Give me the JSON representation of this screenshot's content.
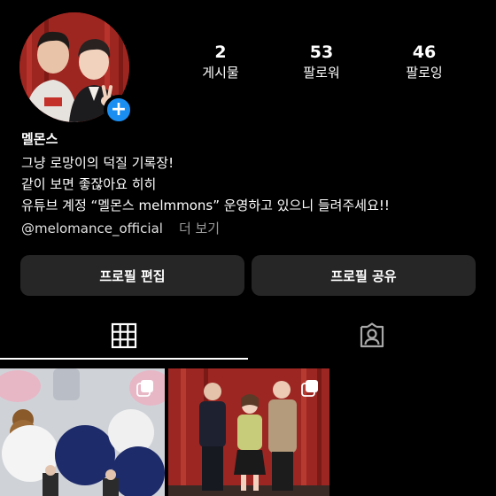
{
  "profile": {
    "display_name": "멜몬스",
    "bio_lines": [
      "그냥 로망이의 덕질 기록장!",
      "같이 보면 좋잖아요 히히",
      "유튜브 계정 “멜몬스 melmmons” 운영하고 있으니 들려주세요!!"
    ],
    "link_handle": "@melomance_official",
    "more_label": "더 보기"
  },
  "stats": [
    {
      "value": "2",
      "label": "게시물"
    },
    {
      "value": "53",
      "label": "팔로워"
    },
    {
      "value": "46",
      "label": "팔로잉"
    }
  ],
  "actions": {
    "edit_profile": "프로필 편집",
    "share_profile": "프로필 공유"
  },
  "tabs": [
    {
      "icon": "grid-icon",
      "selected": true
    },
    {
      "icon": "tagged-person-icon",
      "selected": false
    }
  ],
  "colors": {
    "background": "#000000",
    "button_bg": "#262626",
    "accent_blue": "#1b8ef2",
    "muted_text": "#9a9a9a"
  }
}
